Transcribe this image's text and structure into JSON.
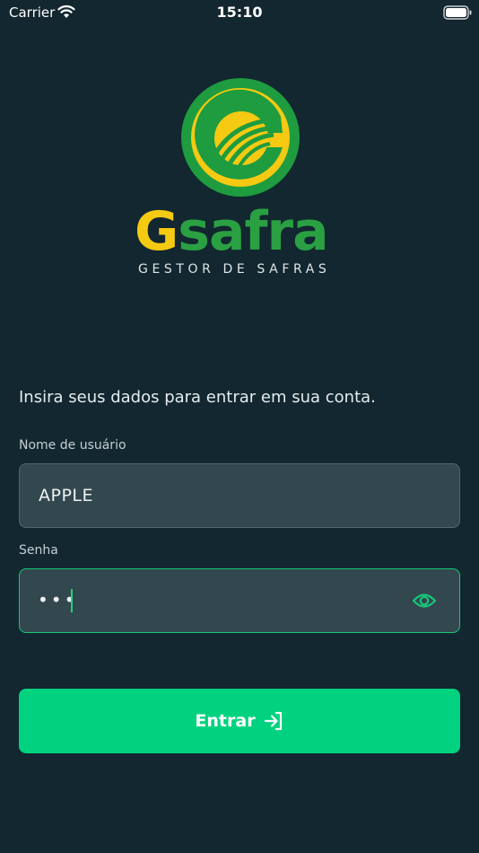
{
  "status_bar": {
    "carrier": "Carrier",
    "time": "15:10"
  },
  "logo": {
    "wordmark_g": "G",
    "wordmark_rest": "safra",
    "tagline": "GESTOR DE SAFRAS",
    "colors": {
      "green": "#1e9c3f",
      "yellow": "#f6c912"
    }
  },
  "login": {
    "intro": "Insira seus dados para entrar em sua conta.",
    "username_label": "Nome de usuário",
    "username_value": "APPLE",
    "password_label": "Senha",
    "password_value": "•••",
    "submit_label": "Entrar"
  },
  "icons": {
    "status": [
      "wifi-icon",
      "battery-icon"
    ],
    "password_toggle": "eye-icon",
    "submit": "login-arrow-icon"
  },
  "theme": {
    "background": "#12272f",
    "input_background": "#33474e",
    "accent": "#00d27f"
  }
}
